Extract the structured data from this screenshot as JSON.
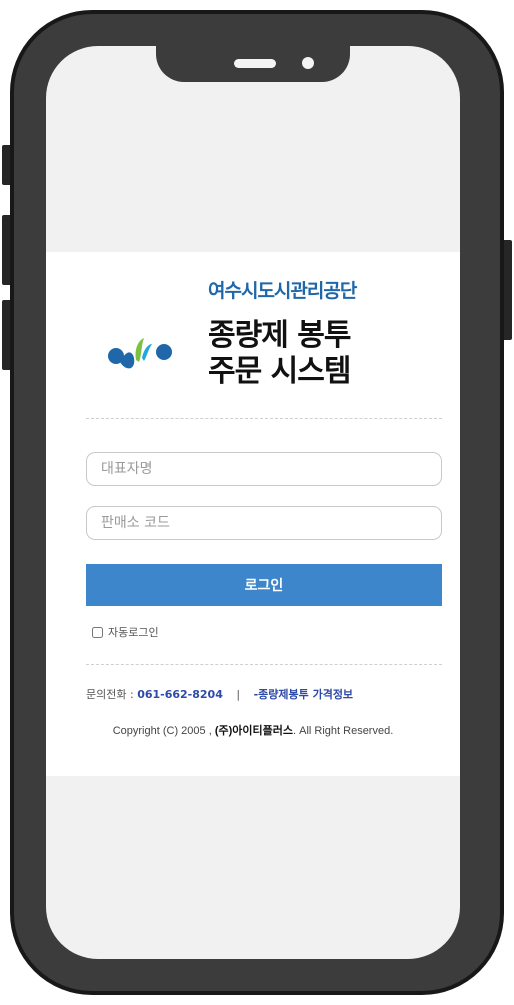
{
  "header": {
    "org_name": "여수시도시관리공단",
    "title_line1": "종량제 봉투",
    "title_line2": "주문 시스템"
  },
  "form": {
    "representative_placeholder": "대표자명",
    "store_code_placeholder": "판매소 코드",
    "login_label": "로그인",
    "auto_login_label": "자동로그인"
  },
  "footer": {
    "contact_label": "문의전화 :",
    "contact_phone": "061-662-8204",
    "separator": "|",
    "price_link": "-종량제봉투 가격정보",
    "copyright_prefix": "Copyright (C) 2005 ,",
    "company": "(주)아이티플러스",
    "copyright_suffix": ". All Right Reserved."
  },
  "colors": {
    "brand_blue": "#1f67a8",
    "button_blue": "#3d86cb",
    "logo_green": "#7cc242",
    "logo_cyan": "#22a8df",
    "link_blue": "#2d4aa8"
  }
}
